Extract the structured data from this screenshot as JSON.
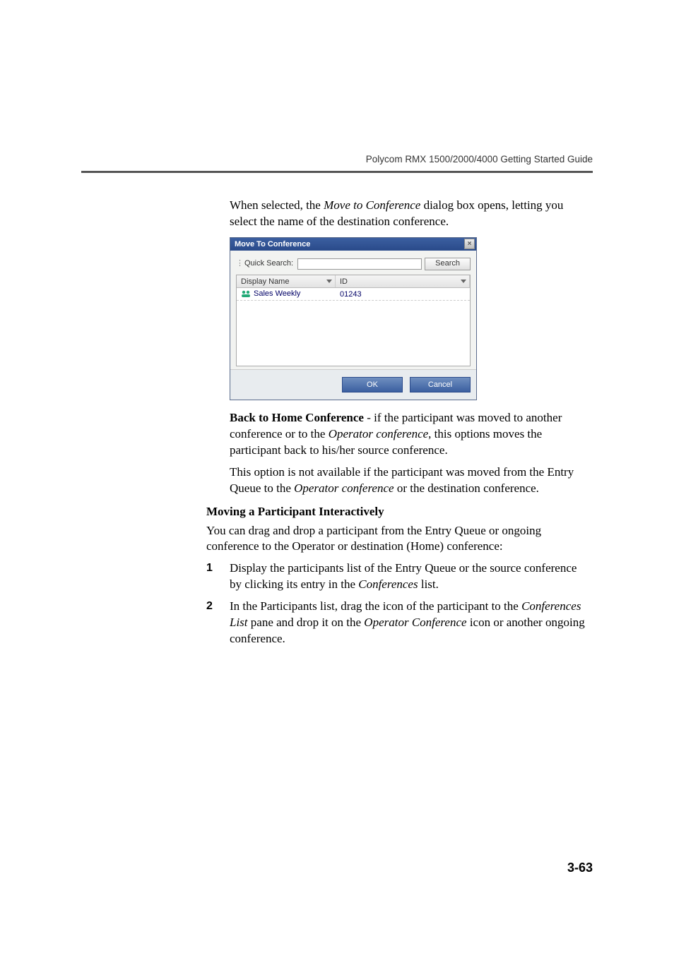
{
  "header": {
    "running_head": "Polycom RMX 1500/2000/4000 Getting Started Guide"
  },
  "intro": {
    "text_before": "When selected, the ",
    "italic": "Move to Conference",
    "text_after": " dialog box opens, letting you select the name of the destination conference."
  },
  "dialog": {
    "title": "Move To Conference",
    "close_glyph": "×",
    "dots": "⋮",
    "quick_search_label": "Quick Search:",
    "search_btn": "Search",
    "columns": {
      "display_name": "Display Name",
      "id": "ID"
    },
    "rows": [
      {
        "name": "Sales Weekly",
        "id": "01243"
      }
    ],
    "buttons": {
      "ok": "OK",
      "cancel": "Cancel"
    }
  },
  "back_home": {
    "bold": "Back to Home Conference",
    "text_before": " - if the participant was moved to another conference or to the ",
    "italic": "Operator conference",
    "text_after": ", this options moves the participant back to his/her source conference."
  },
  "note": {
    "text_before": "This option is not available if the participant was moved from the Entry Queue to the ",
    "italic": "Operator conference",
    "text_after": " or the destination conference."
  },
  "subhead": "Moving a Participant Interactively",
  "after_sub": "You can drag and drop a participant from the Entry Queue or ongoing conference to the Operator or destination (Home) conference:",
  "steps": [
    {
      "num": "1",
      "text_before": "Display the participants list of the Entry Queue or the source conference by clicking its entry in the ",
      "italic": "Conferences",
      "text_after": " list."
    },
    {
      "num": "2",
      "text_before": "In the Participants list, drag the icon of the participant to the ",
      "italic1": "Conferences List",
      "mid": " pane and drop it on the ",
      "italic2": "Operator Conference",
      "text_after": " icon or another ongoing conference."
    }
  ],
  "page_number": "3-63"
}
